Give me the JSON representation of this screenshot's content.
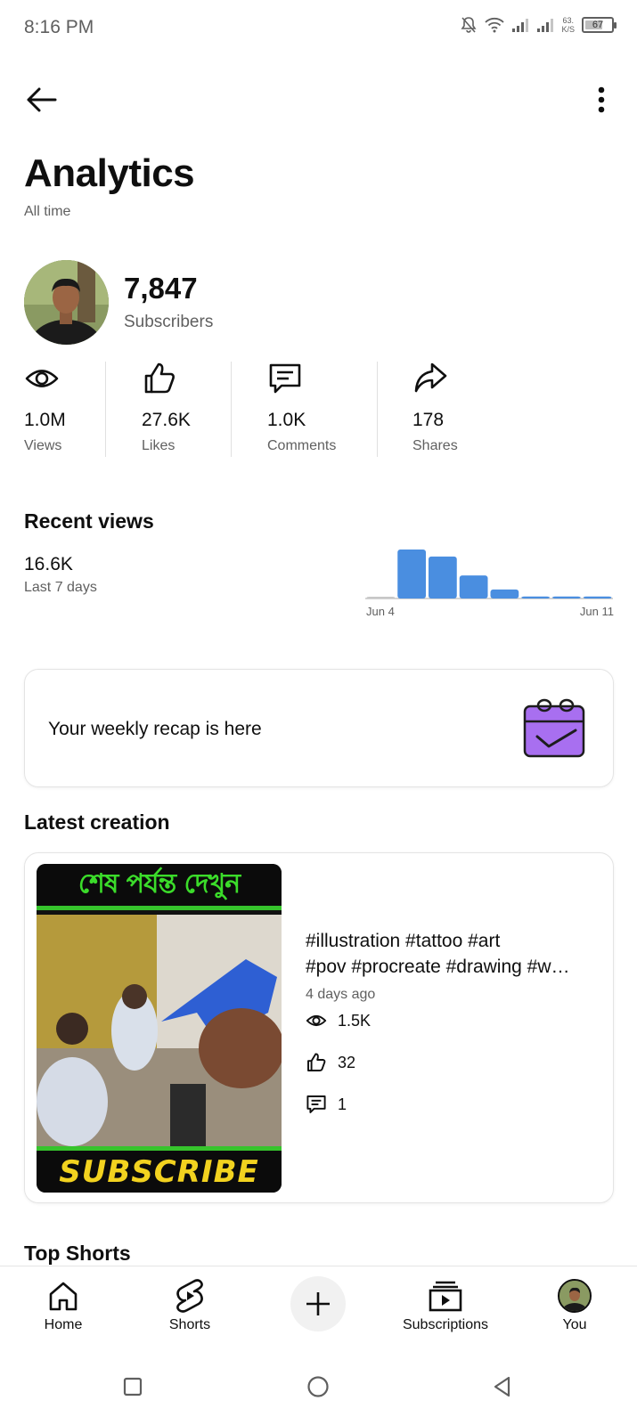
{
  "status_bar": {
    "time": "8:16 PM",
    "net_speed_value": "63.",
    "net_speed_unit": "K/S",
    "battery_level": "67",
    "battery_fraction": 0.67
  },
  "header": {
    "title": "Analytics",
    "subtitle": "All time"
  },
  "channel": {
    "subscriber_count": "7,847",
    "subscriber_label": "Subscribers"
  },
  "stats": [
    {
      "icon": "eye-icon",
      "value": "1.0M",
      "label": "Views"
    },
    {
      "icon": "thumbs-up-icon",
      "value": "27.6K",
      "label": "Likes"
    },
    {
      "icon": "comment-icon",
      "value": "1.0K",
      "label": "Comments"
    },
    {
      "icon": "share-icon",
      "value": "178",
      "label": "Shares"
    }
  ],
  "recent_views": {
    "title": "Recent views",
    "value": "16.6K",
    "label": "Last 7 days"
  },
  "chart_data": {
    "type": "bar",
    "title": "",
    "categories": [
      "",
      "",
      "",
      "",
      "",
      "",
      "",
      ""
    ],
    "values": [
      0.2,
      9.8,
      8.4,
      4.6,
      1.8,
      0.4,
      0.4,
      0.4
    ],
    "x_tick_start": "Jun 4",
    "x_tick_end": "Jun 11",
    "color": "#4a8ee0",
    "baseline_color": "#c7c7c7"
  },
  "recap": {
    "text": "Your weekly recap is here",
    "icon": "calendar-check-icon",
    "icon_color": "#a86ff0"
  },
  "latest_creation": {
    "section_title": "Latest creation",
    "thumbnail_top_text": "শেষ পর্যন্ত দেখুন",
    "thumbnail_bottom_text": "SUBSCRIBE",
    "title_line1": "#illustration #tattoo #art",
    "title_line2": "#pov #procreate #drawing #w…",
    "age": "4 days ago",
    "views": "1.5K",
    "likes": "32",
    "comments": "1"
  },
  "top_shorts": {
    "title": "Top Shorts"
  },
  "bottom_nav": {
    "home": "Home",
    "shorts": "Shorts",
    "subscriptions": "Subscriptions",
    "you": "You"
  },
  "colors": {
    "text": "#0f0f0f",
    "secondary_text": "#606060",
    "accent_blue": "#4a8ee0",
    "thumb_green": "#36c42c",
    "thumb_yellow": "#f2d21f"
  }
}
